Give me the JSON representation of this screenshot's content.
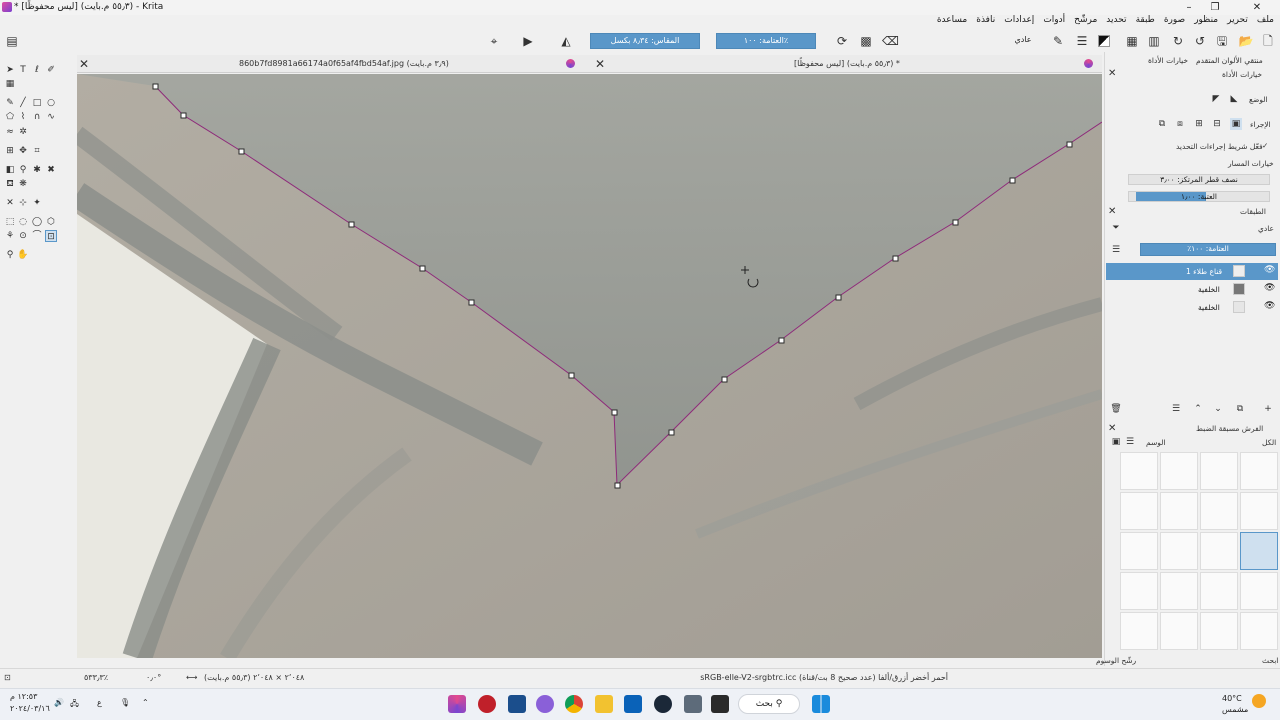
{
  "window": {
    "title": "* [ليس محفوظًا] (٥٥٫٣ م.بايت) - Krita",
    "minimize": "–",
    "maximize": "❐",
    "close": "✕"
  },
  "menu": [
    "ملف",
    "تحرير",
    "منظور",
    "صورة",
    "طبقة",
    "تحديد",
    "مرشّح",
    "أدوات",
    "إعدادات",
    "نافذة",
    "مساعدة"
  ],
  "toolbar": {
    "blend_mode": "عادي",
    "opacity": "العتامة: ١٠٠٪",
    "size": "المقاس: ٨٫٣٤ بكسل"
  },
  "tabs": [
    {
      "title": "860b7fd8981a66174a0f65af4fbd54af.jpg (٣٫٩ م.بايت)"
    },
    {
      "title": "[ليس محفوظًا] (٥٥٫٣ م.بايت) *"
    }
  ],
  "right_panel": {
    "docker_tabs": [
      "منتقي الألوان المتقدم",
      "خيارات الأداة"
    ],
    "tool_options_title": "خيارات الأداة",
    "mode_label": "الوضع",
    "action_label": "الإجراء",
    "show_action_bar": "فعّل شريط إجراءات التحديد",
    "path_options": "خيارات المسار",
    "anchor_radius": "نصف قطر المرتكز: ٣٫٠٠",
    "threshold": "العتبة: ١٫٠٠",
    "layers_title": "الطبقات",
    "layer_blend": "عادي",
    "layer_opacity": "العتامة: ١٠٠٪",
    "layers": [
      {
        "name": "قناع طلاء 1",
        "selected": true
      },
      {
        "name": "الخلفية",
        "selected": false
      },
      {
        "name": "الخلفية",
        "selected": false
      }
    ],
    "presets_title": "الفرش مسبقة الضبط",
    "presets_filter": "الكل",
    "presets_tag": "الوسم",
    "presets_search": "رشّح الوسوم",
    "presets_search_label": "ابحث"
  },
  "status": {
    "color_profile": "أحمر أخضر أزرق/ألفا (عدد صحيح 8 بت/قناة)  sRGB-elle-V2-srgbtrc.icc",
    "dimensions": "(٥٥٫٣ م.بايت) ٢٬٠٤٨ × ٢٬٠٤٨",
    "zoom": "٥٣٣٫٣٪",
    "rotation": "٠٫٠°"
  },
  "taskbar": {
    "search": "بحث",
    "time": "١٢:٥٣ م",
    "date": "٢٠٢٤/٠٣/١٦",
    "lang": "ع",
    "weather_temp": "40°C",
    "weather_desc": "مشمس"
  },
  "colors": {
    "accent": "#5a97c9",
    "path": "#8e2a7a",
    "canvas": "#a8a49c"
  }
}
